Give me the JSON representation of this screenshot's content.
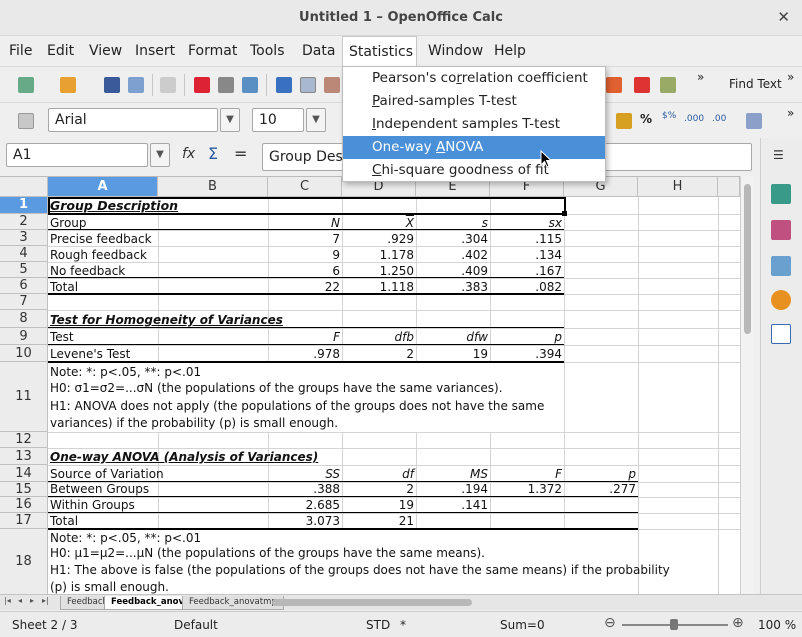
{
  "window": {
    "title": "Untitled 1 – OpenOffice Calc",
    "close": "✕"
  },
  "menubar": [
    "File",
    "Edit",
    "View",
    "Insert",
    "Format",
    "Tools",
    "Data",
    "Statistics",
    "Window",
    "Help"
  ],
  "statistics_menu": {
    "items": [
      {
        "pre": "Pearson's co",
        "u": "r",
        "post": "relation coefficient"
      },
      {
        "pre": "",
        "u": "P",
        "post": "aired-samples T-test"
      },
      {
        "pre": "",
        "u": "I",
        "post": "ndependent samples T-test"
      },
      {
        "pre": "One-way ",
        "u": "A",
        "post": "NOVA"
      },
      {
        "pre": "",
        "u": "C",
        "post": "hi-square goodness of fit"
      }
    ],
    "selected_index": 3
  },
  "toolbar": {
    "find_text": "Find Text",
    "overflow": "»"
  },
  "format_bar": {
    "font_name": "Arial",
    "font_size": "10",
    "currency": "$%",
    "percent": "%",
    "decimal_add": ".000",
    "decimal_remove": ".00"
  },
  "formula_bar": {
    "name_box": "A1",
    "content": "Group Desc",
    "func_icon": "fx",
    "sum_icon": "Σ",
    "equals": "="
  },
  "columns": [
    "A",
    "B",
    "C",
    "D",
    "E",
    "F",
    "G",
    "H"
  ],
  "rows": [
    "1",
    "2",
    "3",
    "4",
    "5",
    "6",
    "7",
    "8",
    "9",
    "10",
    "11",
    "12",
    "13",
    "14",
    "15",
    "16",
    "17",
    "18"
  ],
  "sheet": {
    "r1": {
      "a": "Group Description"
    },
    "r2": {
      "a": "Group",
      "c": "N",
      "d": "X",
      "e": "s",
      "f": "sx"
    },
    "r3": {
      "a": "Precise feedback",
      "c": "7",
      "d": ".929",
      "e": ".304",
      "f": ".115"
    },
    "r4": {
      "a": "Rough feedback",
      "c": "9",
      "d": "1.178",
      "e": ".402",
      "f": ".134"
    },
    "r5": {
      "a": "No feedback",
      "c": "6",
      "d": "1.250",
      "e": ".409",
      "f": ".167"
    },
    "r6": {
      "a": "Total",
      "c": "22",
      "d": "1.118",
      "e": ".383",
      "f": ".082"
    },
    "r8": {
      "a": "Test for Homogeneity of Variances"
    },
    "r9": {
      "a": "Test",
      "c": "F",
      "d": "dfb",
      "e": "dfw",
      "f": "p"
    },
    "r10": {
      "a": "Levene's Test",
      "c": ".978",
      "d": "2",
      "e": "19",
      "f": ".394"
    },
    "r11": {
      "l1": "Note: *: p<.05, **: p<.01",
      "l2": "H0: σ1=σ2=...σN (the populations of the groups have the same variances).",
      "l3": "H1: ANOVA does not apply (the populations of the groups does not have the same",
      "l4": "variances) if the probability (p) is small enough."
    },
    "r13": {
      "a": "One-way ANOVA (Analysis of Variances)"
    },
    "r14": {
      "a": "Source of Variation",
      "c": "SS",
      "d": "df",
      "e": "MS",
      "f": "F",
      "g": "p"
    },
    "r15": {
      "a": "Between Groups",
      "c": ".388",
      "d": "2",
      "e": ".194",
      "f": "1.372",
      "g": ".277"
    },
    "r16": {
      "a": "Within Groups",
      "c": "2.685",
      "d": "19",
      "e": ".141"
    },
    "r17": {
      "a": "Total",
      "c": "3.073",
      "d": "21"
    },
    "r18": {
      "l1": "Note: *: p<.05, **: p<.01",
      "l2": "H0: μ1=μ2=...μN (the populations of the groups have the same means).",
      "l3": "H1: The above is false (the populations of the groups does not have the same means) if the probability",
      "l4": "(p) is small enough."
    }
  },
  "sheet_tabs": [
    "Feedback",
    "Feedback_anova",
    "Feedback_anovatmp"
  ],
  "status": {
    "sheet": "Sheet 2 / 3",
    "style": "Default",
    "mode": "STD",
    "modified": "*",
    "sum": "Sum=0",
    "zoom": "100 %"
  }
}
